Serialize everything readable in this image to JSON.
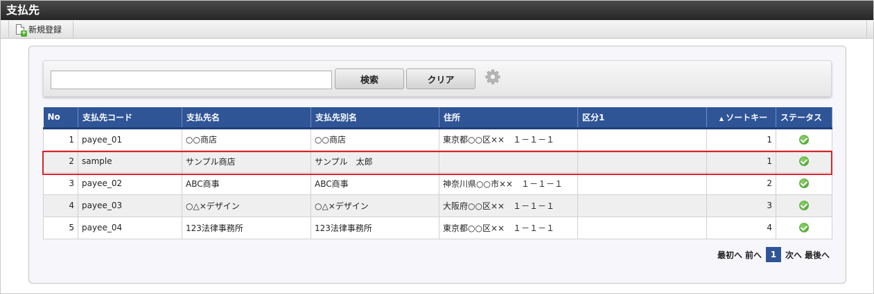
{
  "title": "支払先",
  "toolbar": {
    "new_label": "新規登録"
  },
  "search": {
    "value": "",
    "placeholder": "",
    "search_label": "検索",
    "clear_label": "クリア"
  },
  "table": {
    "columns": [
      "No",
      "支払先コード",
      "支払先名",
      "支払先別名",
      "住所",
      "区分1",
      "ソートキー",
      "ステータス"
    ],
    "sort_indicator": "▲",
    "rows": [
      {
        "no": "1",
        "code": "payee_01",
        "name": "○○商店",
        "alias": "○○商店",
        "address": "東京都○○区××　１－１－１",
        "kubun": "",
        "sortkey": "1",
        "status": "check-circle-icon"
      },
      {
        "no": "2",
        "code": "sample",
        "name": "サンプル商店",
        "alias": "サンプル　太郎",
        "address": "",
        "kubun": "",
        "sortkey": "1",
        "status": "check-circle-icon"
      },
      {
        "no": "3",
        "code": "payee_02",
        "name": "ABC商事",
        "alias": "ABC商事",
        "address": "神奈川県○○市××　１－１－１",
        "kubun": "",
        "sortkey": "2",
        "status": "check-circle-icon"
      },
      {
        "no": "4",
        "code": "payee_03",
        "name": "○△×デザイン",
        "alias": "○△×デザイン",
        "address": "大阪府○○区××　１－１－１",
        "kubun": "",
        "sortkey": "3",
        "status": "check-circle-icon"
      },
      {
        "no": "5",
        "code": "payee_04",
        "name": "123法律事務所",
        "alias": "123法律事務所",
        "address": "東京都○○区××　１－１－１",
        "kubun": "",
        "sortkey": "4",
        "status": "check-circle-icon"
      }
    ]
  },
  "pager": {
    "first": "最初へ",
    "prev": "前へ",
    "current": "1",
    "next": "次へ",
    "last": "最後へ"
  },
  "colors": {
    "header": "#2f5597",
    "highlight": "#e0202a",
    "status_ok": "#3a9b1f"
  }
}
